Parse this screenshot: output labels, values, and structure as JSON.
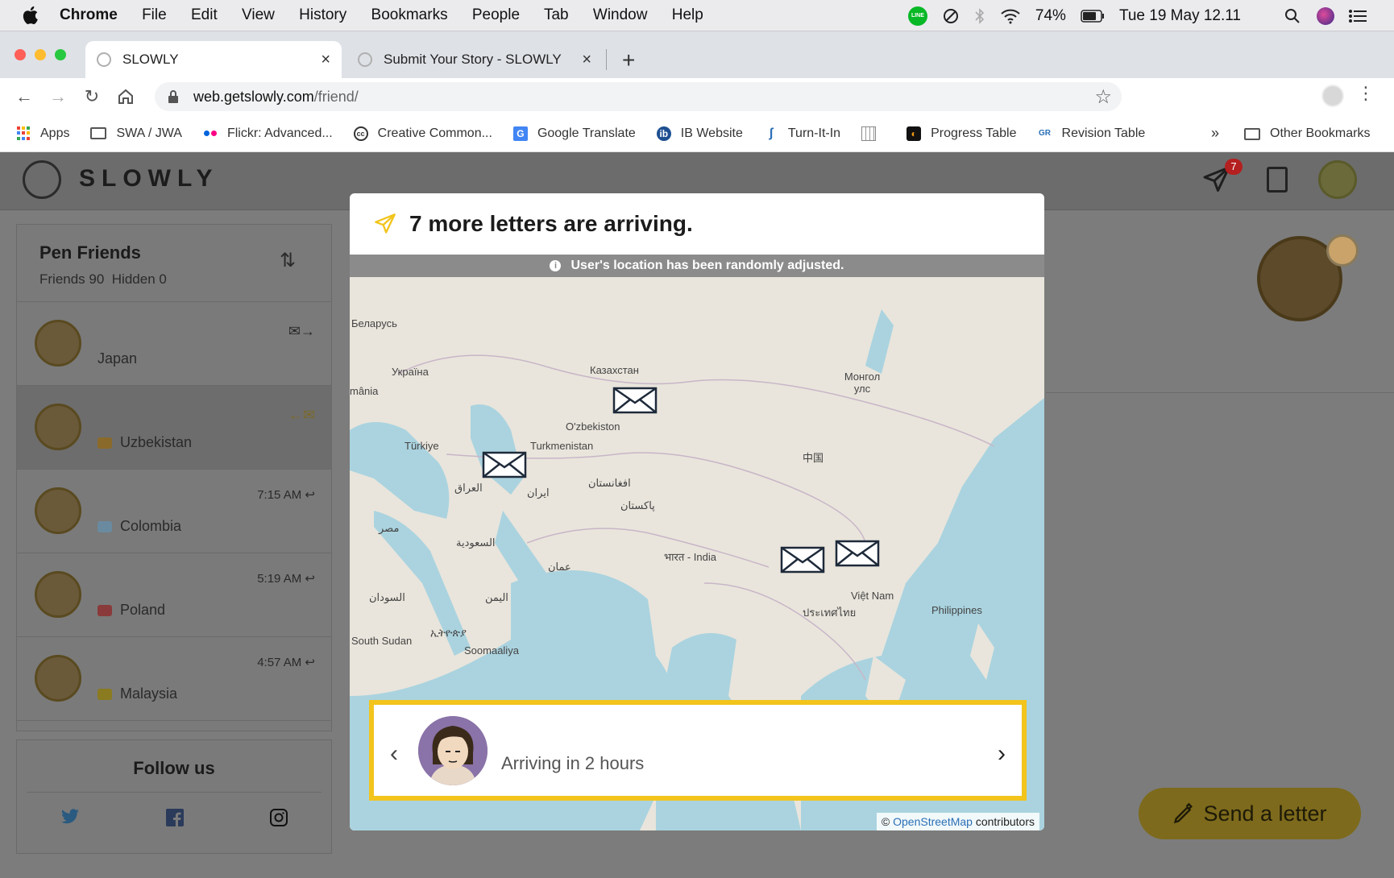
{
  "menubar": {
    "app": "Chrome",
    "menus": [
      "File",
      "Edit",
      "View",
      "History",
      "Bookmarks",
      "People",
      "Tab",
      "Window",
      "Help"
    ],
    "line_label": "LINE",
    "battery": "74%",
    "datetime": "Tue 19 May  12.11"
  },
  "browser": {
    "tabs": [
      {
        "title": "SLOWLY"
      },
      {
        "title": "Submit Your Story - SLOWLY"
      }
    ],
    "url_host": "web.getslowly.com",
    "url_path": "/friend/",
    "bookmarks": [
      {
        "label": "Apps",
        "icon": "apps-grid-icon"
      },
      {
        "label": "SWA / JWA",
        "icon": "folder-icon"
      },
      {
        "label": "Flickr: Advanced...",
        "icon": "flickr-icon"
      },
      {
        "label": "Creative Common...",
        "icon": "cc-icon"
      },
      {
        "label": "Google Translate",
        "icon": "google-translate-icon"
      },
      {
        "label": "IB Website",
        "icon": "ib-icon"
      },
      {
        "label": "Turn-It-In",
        "icon": "turnitin-icon"
      },
      {
        "label": "",
        "icon": "grid-icon"
      },
      {
        "label": "Progress Table",
        "icon": "progress-icon"
      },
      {
        "label": "Revision Table",
        "icon": "revision-icon"
      }
    ],
    "bookmarks_more": "»",
    "other_bookmarks": "Other Bookmarks"
  },
  "app": {
    "logo_text": "SLOWLY",
    "notification_count": "7"
  },
  "sidebar": {
    "title": "Pen Friends",
    "friends_count": "Friends 90",
    "hidden_count": "Hidden 0",
    "friends": [
      {
        "country": "Japan",
        "time": "",
        "status_icon": "outgoing-mail-icon",
        "flag_color": ""
      },
      {
        "country": "Uzbekistan",
        "time": "",
        "status_icon": "incoming-mail-icon",
        "flag_color": "#8a6a2a"
      },
      {
        "country": "Colombia",
        "time": "7:15 AM",
        "status_icon": "reply-icon",
        "flag_color": "#6a8aa0"
      },
      {
        "country": "Poland",
        "time": "5:19 AM",
        "status_icon": "reply-icon",
        "flag_color": "#8a3a3a"
      },
      {
        "country": "Malaysia",
        "time": "4:57 AM",
        "status_icon": "reply-icon",
        "flag_color": "#8a7a20"
      }
    ],
    "follow_title": "Follow us"
  },
  "send_button": "Send a letter",
  "modal": {
    "title": "7 more letters are arriving.",
    "notice": "User's location has been randomly adjusted.",
    "arrival_text": "Arriving in 2 hours",
    "attribution_prefix": "©",
    "attribution_link": "OpenStreetMap",
    "attribution_suffix": "contributors",
    "map_labels": [
      "Беларусь",
      "Україна",
      "Казахстан",
      "Монгол улс",
      "mânia",
      "Türkiye",
      "O'zbekiston",
      "Turkmenistan",
      "العراق",
      "ایران",
      "افغانستان",
      "پاکستان",
      "مصر",
      "السعودية",
      "عمان",
      "भारत - India",
      "中国",
      "Việt Nam",
      "Philippines",
      "السودان",
      "اليمن",
      "South Sudan",
      "ኢትዮጵያ",
      "Soomaaliya",
      "ประเทศไทย"
    ]
  },
  "colors": {
    "accent_yellow": "#f2c41c",
    "overlay_bg": "#7c7c7c",
    "link_blue": "#2a6fb6",
    "badge_red": "#b41f1f"
  }
}
